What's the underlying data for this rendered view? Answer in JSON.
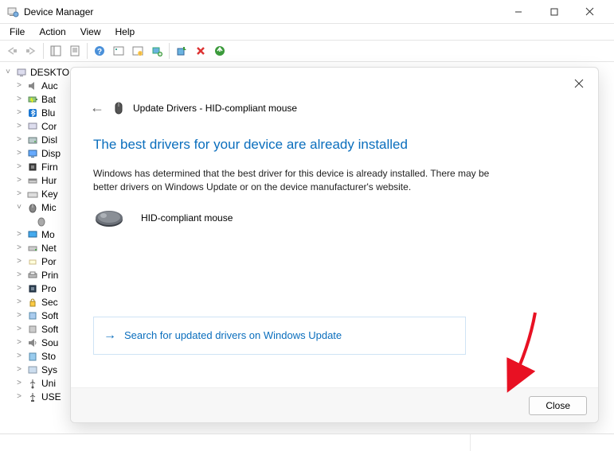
{
  "window": {
    "title": "Device Manager"
  },
  "menu": {
    "file": "File",
    "action": "Action",
    "view": "View",
    "help": "Help"
  },
  "tree": {
    "root": "DESKTO",
    "items": [
      {
        "label": "Auc",
        "icon": "audio"
      },
      {
        "label": "Bat",
        "icon": "battery"
      },
      {
        "label": "Blu",
        "icon": "bluetooth"
      },
      {
        "label": "Cor",
        "icon": "computer"
      },
      {
        "label": "Disl",
        "icon": "disk"
      },
      {
        "label": "Disp",
        "icon": "display"
      },
      {
        "label": "Firn",
        "icon": "firmware"
      },
      {
        "label": "Hur",
        "icon": "hid"
      },
      {
        "label": "Key",
        "icon": "keyboard"
      },
      {
        "label": "Mic",
        "icon": "mouse",
        "expanded": true,
        "children": [
          {
            "label": "",
            "icon": "mouse-dev"
          }
        ]
      },
      {
        "label": "Mo",
        "icon": "monitor"
      },
      {
        "label": "Net",
        "icon": "network"
      },
      {
        "label": "Por",
        "icon": "port"
      },
      {
        "label": "Prin",
        "icon": "printer"
      },
      {
        "label": "Pro",
        "icon": "processor"
      },
      {
        "label": "Sec",
        "icon": "security"
      },
      {
        "label": "Soft",
        "icon": "soft1"
      },
      {
        "label": "Soft",
        "icon": "soft2"
      },
      {
        "label": "Sou",
        "icon": "sound"
      },
      {
        "label": "Sto",
        "icon": "storage"
      },
      {
        "label": "Sys",
        "icon": "system"
      },
      {
        "label": "Uni",
        "icon": "usb"
      },
      {
        "label": "USE",
        "icon": "usb-ctrl"
      }
    ]
  },
  "dialog": {
    "title": "Update Drivers - HID-compliant mouse",
    "heading": "The best drivers for your device are already installed",
    "description": "Windows has determined that the best driver for this device is already installed. There may be better drivers on Windows Update or on the device manufacturer's website.",
    "device": "HID-compliant mouse",
    "link": "Search for updated drivers on Windows Update",
    "close": "Close"
  }
}
